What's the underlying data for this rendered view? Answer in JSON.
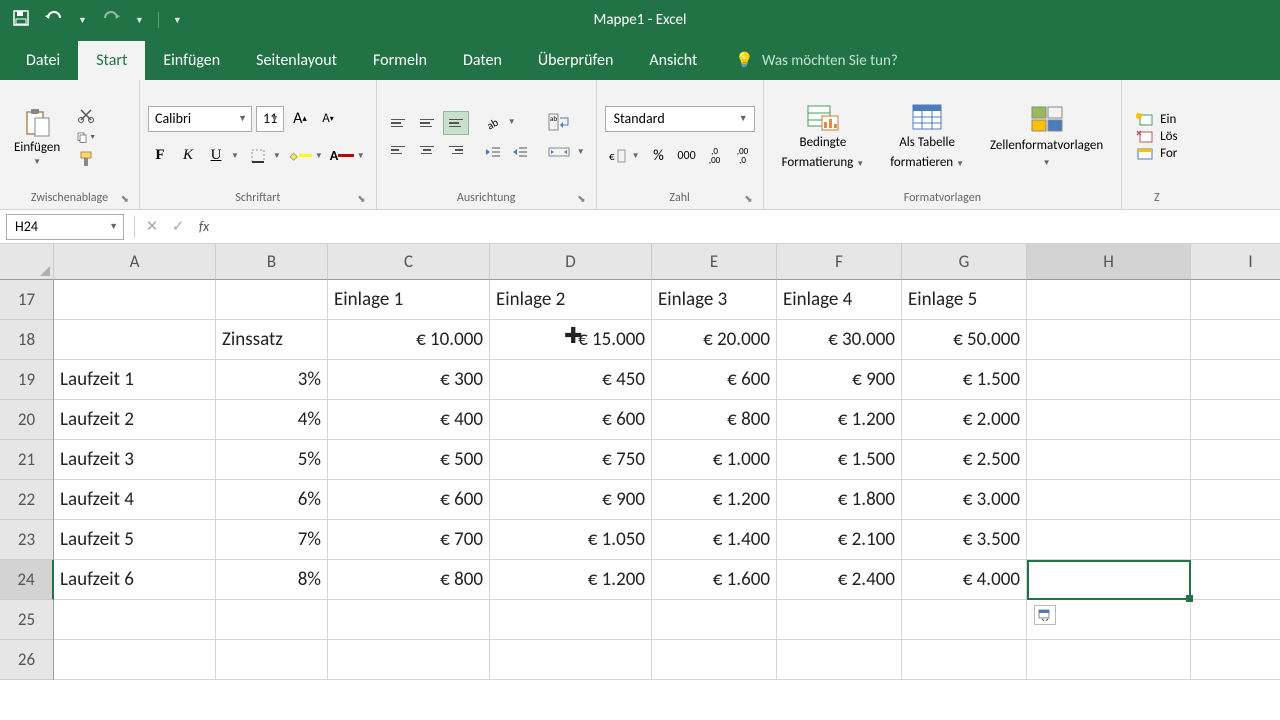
{
  "app": {
    "title": "Mappe1 - Excel"
  },
  "tabs": {
    "t0": "Datei",
    "t1": "Start",
    "t2": "Einfügen",
    "t3": "Seitenlayout",
    "t4": "Formeln",
    "t5": "Daten",
    "t6": "Überprüfen",
    "t7": "Ansicht",
    "tellme": "Was möchten Sie tun?"
  },
  "ribbon": {
    "clipboard": {
      "paste": "Einfügen",
      "label": "Zwischenablage"
    },
    "font": {
      "name": "Calibri",
      "size": "11",
      "label": "Schriftart"
    },
    "alignment": {
      "label": "Ausrichtung"
    },
    "number": {
      "format": "Standard",
      "label": "Zahl"
    },
    "styles": {
      "cond_l1": "Bedingte",
      "cond_l2": "Formatierung",
      "table_l1": "Als Tabelle",
      "table_l2": "formatieren",
      "cellstyles": "Zellenformatvorlagen",
      "label": "Formatvorlagen"
    },
    "cells": {
      "insert": "Ein",
      "delete": "Lös",
      "format": "For",
      "label": "Z"
    }
  },
  "fbar": {
    "ref": "H24"
  },
  "cols": {
    "A": "A",
    "B": "B",
    "C": "C",
    "D": "D",
    "E": "E",
    "F": "F",
    "G": "G",
    "H": "H",
    "I": "I"
  },
  "rows": {
    "r17": "17",
    "r18": "18",
    "r19": "19",
    "r20": "20",
    "r21": "21",
    "r22": "22",
    "r23": "23",
    "r24": "24",
    "r25": "25",
    "r26": "26"
  },
  "data": {
    "r17": {
      "C": "Einlage 1",
      "D": "Einlage 2",
      "E": "Einlage 3",
      "F": "Einlage 4",
      "G": "Einlage 5"
    },
    "r18": {
      "B": "Zinssatz",
      "C": "€ 10.000",
      "D": "€ 15.000",
      "E": "€ 20.000",
      "F": "€ 30.000",
      "G": "€ 50.000"
    },
    "r19": {
      "A": "Laufzeit 1",
      "B": "3%",
      "C": "€ 300",
      "D": "€ 450",
      "E": "€ 600",
      "F": "€ 900",
      "G": "€ 1.500"
    },
    "r20": {
      "A": "Laufzeit 2",
      "B": "4%",
      "C": "€ 400",
      "D": "€ 600",
      "E": "€ 800",
      "F": "€ 1.200",
      "G": "€ 2.000"
    },
    "r21": {
      "A": "Laufzeit 3",
      "B": "5%",
      "C": "€ 500",
      "D": "€ 750",
      "E": "€ 1.000",
      "F": "€ 1.500",
      "G": "€ 2.500"
    },
    "r22": {
      "A": "Laufzeit 4",
      "B": "6%",
      "C": "€ 600",
      "D": "€ 900",
      "E": "€ 1.200",
      "F": "€ 1.800",
      "G": "€ 3.000"
    },
    "r23": {
      "A": "Laufzeit 5",
      "B": "7%",
      "C": "€ 700",
      "D": "€ 1.050",
      "E": "€ 1.400",
      "F": "€ 2.100",
      "G": "€ 3.500"
    },
    "r24": {
      "A": "Laufzeit 6",
      "B": "8%",
      "C": "€ 800",
      "D": "€ 1.200",
      "E": "€ 1.600",
      "F": "€ 2.400",
      "G": "€ 4.000"
    }
  }
}
